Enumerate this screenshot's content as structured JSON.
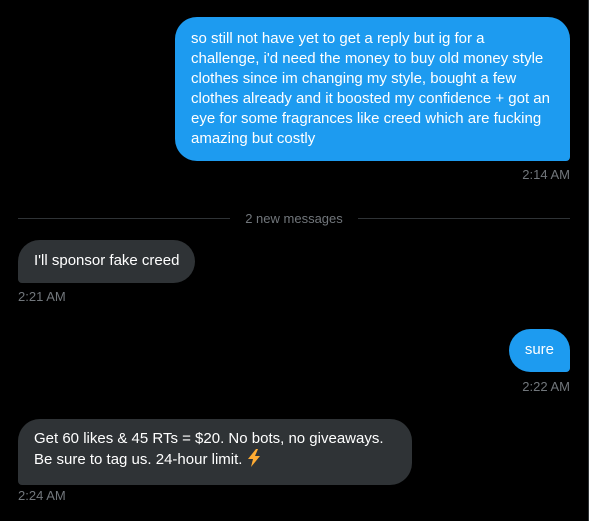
{
  "messages": [
    {
      "direction": "sent",
      "text": "so still not have yet to get a reply but ig for a challenge, i'd need the money to buy old money style clothes since im changing my style, bought a few clothes already and it boosted my confidence + got an eye for some fragrances like creed which are fucking amazing but costly",
      "time": "2:14 AM"
    },
    {
      "direction": "received",
      "text": "I'll sponsor fake creed",
      "time": "2:21 AM"
    },
    {
      "direction": "sent",
      "text": "sure",
      "time": "2:22 AM"
    },
    {
      "direction": "received",
      "text": "Get 60 likes & 45 RTs = $20. No bots, no giveaways. Be sure to tag us. 24-hour limit.",
      "emoji": "lightning-icon",
      "time": "2:24 AM"
    }
  ],
  "divider": {
    "label": "2 new messages"
  },
  "colors": {
    "sent_bubble": "#1d9bf0",
    "received_bubble": "#2f3336",
    "timestamp": "#71767b",
    "background": "#000000"
  }
}
